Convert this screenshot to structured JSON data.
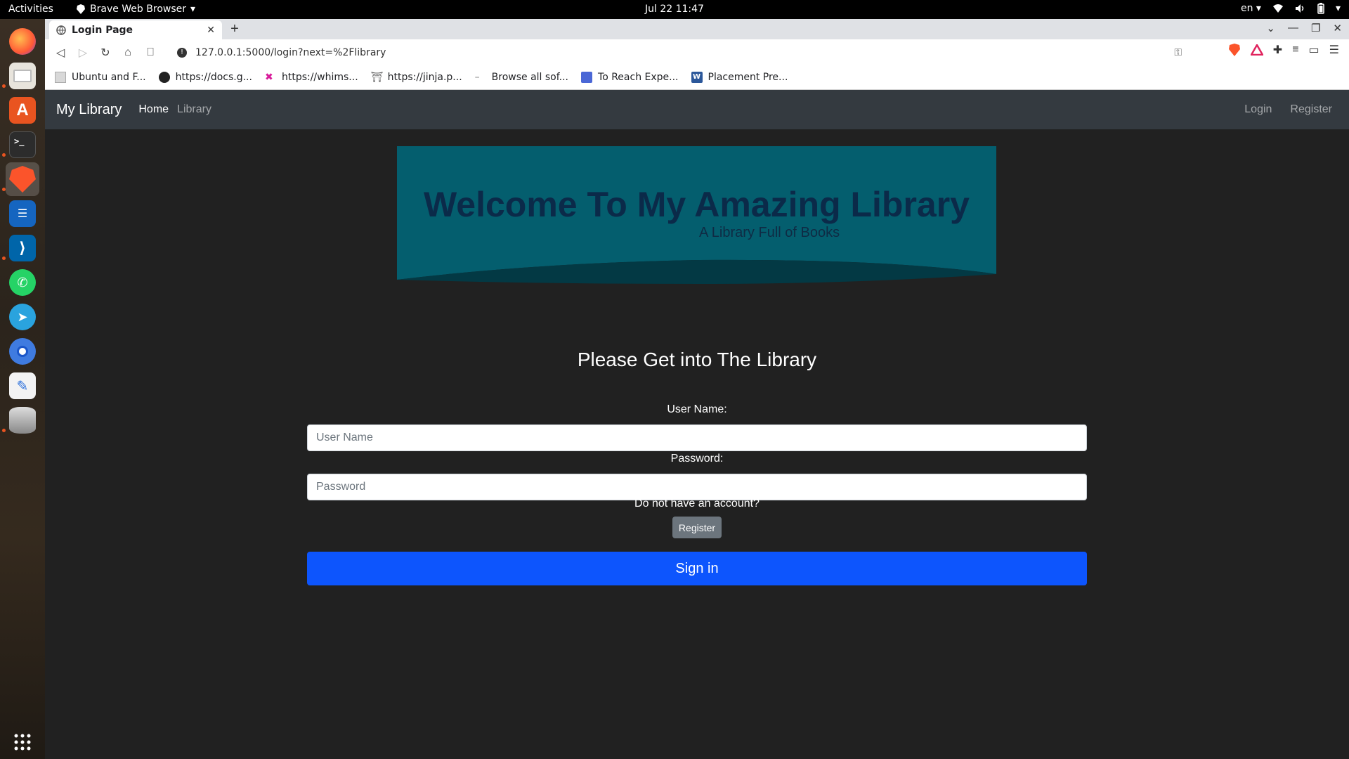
{
  "topbar": {
    "activities": "Activities",
    "app_name": "Brave Web Browser",
    "clock": "Jul 22  11:47",
    "lang": "en"
  },
  "browser": {
    "tab_title": "Login Page",
    "url": "127.0.0.1:5000/login?next=%2Flibrary",
    "bookmarks": [
      {
        "label": "Ubuntu and F..."
      },
      {
        "label": "https://docs.g..."
      },
      {
        "label": "https://whims..."
      },
      {
        "label": "https://jinja.p..."
      },
      {
        "label": "Browse all sof..."
      },
      {
        "label": "To Reach Expe..."
      },
      {
        "label": "Placement Pre..."
      }
    ]
  },
  "navbar": {
    "brand": "My Library",
    "links": [
      "Home",
      "Library"
    ],
    "right_links": [
      "Login",
      "Register"
    ]
  },
  "hero": {
    "title": "Welcome To My Amazing Library",
    "subtitle": "A Library Full of Books"
  },
  "form": {
    "heading": "Please Get into The Library",
    "username_label": "User Name:",
    "username_placeholder": "User Name",
    "password_label": "Password:",
    "password_placeholder": "Password",
    "no_account": "Do not have an account?",
    "register_label": "Register",
    "signin_label": "Sign in"
  },
  "colors": {
    "navbar_bg": "#343a40",
    "hero_bg": "#045e6e",
    "page_bg": "#212121",
    "primary": "#0d55fd",
    "secondary": "#6c757d"
  }
}
